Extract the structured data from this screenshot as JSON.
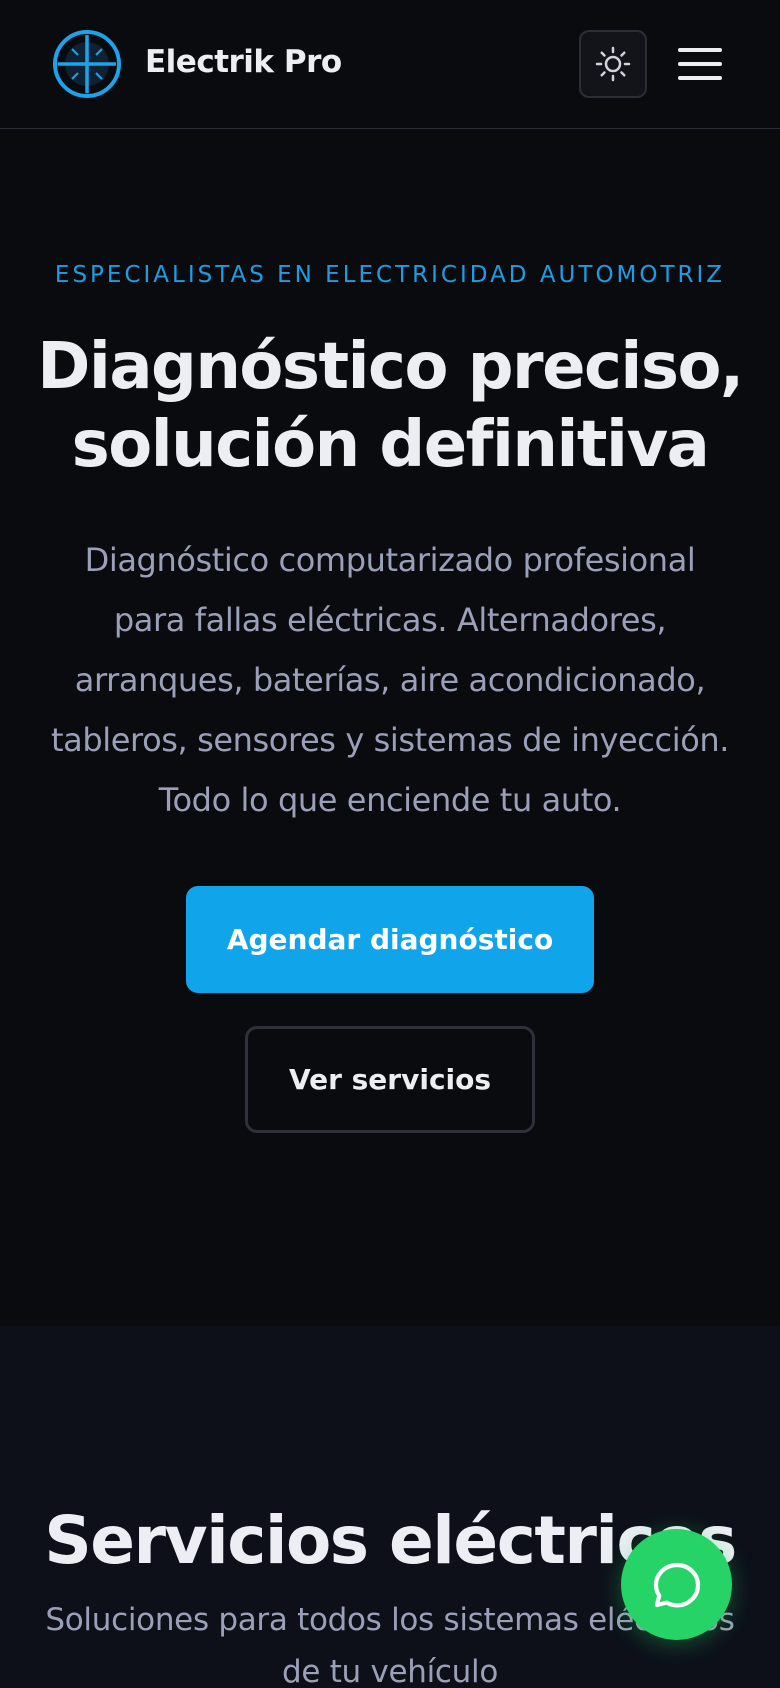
{
  "header": {
    "brand": "Electrik Pro",
    "logo_icon": "crosshair-bolt-icon",
    "theme_toggle_icon": "sun-icon",
    "menu_icon": "hamburger-menu-icon"
  },
  "hero": {
    "eyebrow": "ESPECIALISTAS EN ELECTRICIDAD AUTOMOTRIZ",
    "title_line1": "Diagnóstico preciso,",
    "title_line2": "solución definitiva",
    "description": "Diagnóstico computarizado profesional para fallas eléctricas. Alternadores, arranques, baterías, aire acondicionado, tableros, sensores y sistemas de inyección. Todo lo que enciende tu auto.",
    "primary_cta": "Agendar diagnóstico",
    "secondary_cta": "Ver servicios"
  },
  "services": {
    "title": "Servicios eléctricos",
    "subtitle": "Soluciones para todos los sistemas eléctricos de tu vehículo"
  },
  "floating": {
    "whatsapp_icon": "whatsapp-icon"
  },
  "colors": {
    "accent": "#10a5ea",
    "eyebrow": "#1e9de4",
    "background": "#0a0b0e",
    "section_bg": "#0d1019",
    "whatsapp": "#25d366"
  }
}
